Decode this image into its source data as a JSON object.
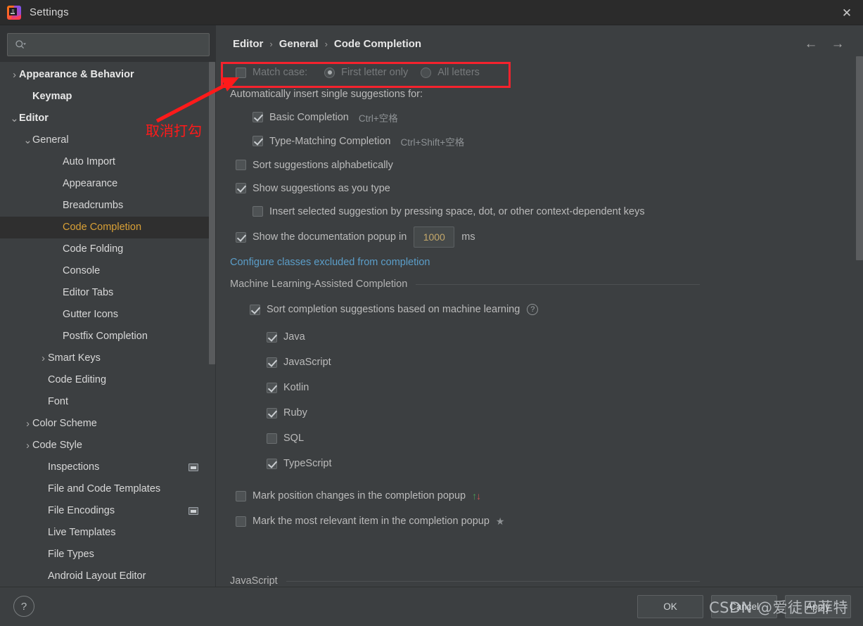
{
  "window": {
    "title": "Settings",
    "logo_name": "intellij-idea-logo",
    "close_label": "✕"
  },
  "search": {
    "placeholder": "",
    "value": "",
    "icon": "search-icon"
  },
  "sidebar": {
    "items": [
      {
        "label": "Appearance & Behavior",
        "indent": 0,
        "arrow": "›",
        "bold": true,
        "selected": false,
        "badge": false
      },
      {
        "label": "Keymap",
        "indent": 1,
        "arrow": "",
        "bold": true,
        "selected": false,
        "badge": false
      },
      {
        "label": "Editor",
        "indent": 0,
        "arrow": "⌄",
        "bold": true,
        "selected": false,
        "badge": false
      },
      {
        "label": "General",
        "indent": 1,
        "arrow": "⌄",
        "bold": false,
        "selected": false,
        "badge": false
      },
      {
        "label": "Auto Import",
        "indent": 3,
        "arrow": "",
        "bold": false,
        "selected": false,
        "badge": false
      },
      {
        "label": "Appearance",
        "indent": 3,
        "arrow": "",
        "bold": false,
        "selected": false,
        "badge": false
      },
      {
        "label": "Breadcrumbs",
        "indent": 3,
        "arrow": "",
        "bold": false,
        "selected": false,
        "badge": false
      },
      {
        "label": "Code Completion",
        "indent": 3,
        "arrow": "",
        "bold": false,
        "selected": true,
        "badge": false
      },
      {
        "label": "Code Folding",
        "indent": 3,
        "arrow": "",
        "bold": false,
        "selected": false,
        "badge": false
      },
      {
        "label": "Console",
        "indent": 3,
        "arrow": "",
        "bold": false,
        "selected": false,
        "badge": false
      },
      {
        "label": "Editor Tabs",
        "indent": 3,
        "arrow": "",
        "bold": false,
        "selected": false,
        "badge": false
      },
      {
        "label": "Gutter Icons",
        "indent": 3,
        "arrow": "",
        "bold": false,
        "selected": false,
        "badge": false
      },
      {
        "label": "Postfix Completion",
        "indent": 3,
        "arrow": "",
        "bold": false,
        "selected": false,
        "badge": false
      },
      {
        "label": "Smart Keys",
        "indent": 2,
        "arrow": "›",
        "bold": false,
        "selected": false,
        "badge": false
      },
      {
        "label": "Code Editing",
        "indent": 2,
        "arrow": "",
        "bold": false,
        "selected": false,
        "badge": false
      },
      {
        "label": "Font",
        "indent": 2,
        "arrow": "",
        "bold": false,
        "selected": false,
        "badge": false
      },
      {
        "label": "Color Scheme",
        "indent": 1,
        "arrow": "›",
        "bold": false,
        "selected": false,
        "badge": false
      },
      {
        "label": "Code Style",
        "indent": 1,
        "arrow": "›",
        "bold": false,
        "selected": false,
        "badge": false
      },
      {
        "label": "Inspections",
        "indent": 2,
        "arrow": "",
        "bold": false,
        "selected": false,
        "badge": true
      },
      {
        "label": "File and Code Templates",
        "indent": 2,
        "arrow": "",
        "bold": false,
        "selected": false,
        "badge": false
      },
      {
        "label": "File Encodings",
        "indent": 2,
        "arrow": "",
        "bold": false,
        "selected": false,
        "badge": true
      },
      {
        "label": "Live Templates",
        "indent": 2,
        "arrow": "",
        "bold": false,
        "selected": false,
        "badge": false
      },
      {
        "label": "File Types",
        "indent": 2,
        "arrow": "",
        "bold": false,
        "selected": false,
        "badge": false
      },
      {
        "label": "Android Layout Editor",
        "indent": 2,
        "arrow": "",
        "bold": false,
        "selected": false,
        "badge": false
      }
    ]
  },
  "breadcrumb": {
    "items": [
      "Editor",
      "General",
      "Code Completion"
    ],
    "separator": "›"
  },
  "nav": {
    "back": "←",
    "forward": "→"
  },
  "settings": {
    "match_case": {
      "label": "Match case:",
      "checked": false,
      "options": [
        {
          "label": "First letter only",
          "selected": true
        },
        {
          "label": "All letters",
          "selected": false
        }
      ]
    },
    "auto_insert_header": "Automatically insert single suggestions for:",
    "auto_insert_items": [
      {
        "label": "Basic Completion",
        "shortcut": "Ctrl+空格",
        "checked": true
      },
      {
        "label": "Type-Matching Completion",
        "shortcut": "Ctrl+Shift+空格",
        "checked": true
      }
    ],
    "sort_alphabetically": {
      "label": "Sort suggestions alphabetically",
      "checked": false
    },
    "show_as_you_type": {
      "label": "Show suggestions as you type",
      "checked": true
    },
    "insert_selected": {
      "label": "Insert selected suggestion by pressing space, dot, or other context-dependent keys",
      "checked": false
    },
    "doc_popup": {
      "label": "Show the documentation popup in",
      "checked": true,
      "value": "1000",
      "unit": "ms"
    },
    "excluded_link": "Configure classes excluded from completion",
    "ml_section_title": "Machine Learning-Assisted Completion",
    "ml_sort": {
      "label": "Sort completion suggestions based on machine learning",
      "checked": true,
      "help": "?"
    },
    "ml_languages": [
      {
        "label": "Java",
        "checked": true
      },
      {
        "label": "JavaScript",
        "checked": true
      },
      {
        "label": "Kotlin",
        "checked": true
      },
      {
        "label": "Ruby",
        "checked": true
      },
      {
        "label": "SQL",
        "checked": false
      },
      {
        "label": "TypeScript",
        "checked": true
      }
    ],
    "mark_position": {
      "label": "Mark position changes in the completion popup",
      "checked": false,
      "icon_up": "↑",
      "icon_down": "↓"
    },
    "mark_relevant": {
      "label": "Mark the most relevant item in the completion popup",
      "checked": false,
      "icon_star": "★"
    },
    "js_section_title": "JavaScript"
  },
  "annotation": {
    "text": "取消打勾",
    "color": "#ff1a1a"
  },
  "footer": {
    "help": "?",
    "ok": "OK",
    "cancel": "Cancel",
    "apply": "Apply"
  },
  "watermark": {
    "text": "CSDN @爱徒巴菲特"
  },
  "colors": {
    "accent_selected": "#d9a036",
    "link": "#5b9ec9",
    "annotation_red": "#ff1a1a",
    "bg_panel": "#3c3f41",
    "bg_titlebar": "#2b2b2b"
  }
}
